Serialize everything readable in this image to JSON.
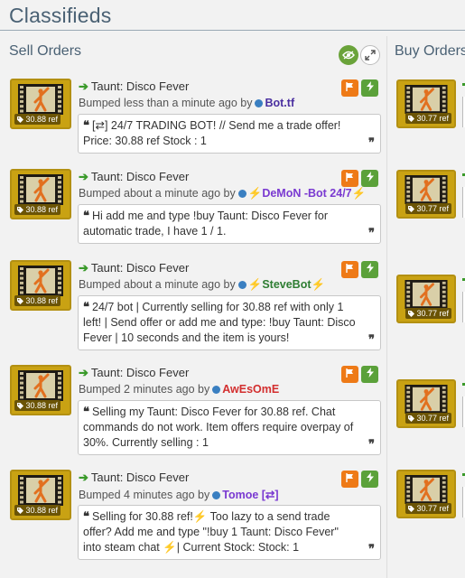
{
  "page": {
    "title": "Classifieds"
  },
  "sections": {
    "sell": "Sell Orders",
    "buy": "Buy Orders"
  },
  "icons": {
    "eye": "eye-icon",
    "expand": "expand-icon",
    "flag": "flag-icon",
    "trade": "lightning-icon",
    "quote_open": "quote-open-icon",
    "quote_close": "quote-close-icon",
    "arrow": "arrow-right-icon"
  },
  "colors": {
    "item_border": "#c9a213",
    "trade_green": "#5ba13a",
    "report_orange": "#ee7a17",
    "online_dot": "#3a7fc1"
  },
  "sell_orders": [
    {
      "item": "Taunt: Disco Fever",
      "price": "30.88 ref",
      "bumped": "Bumped less than a minute ago by",
      "user_prefix": "",
      "user": "Bot.tf",
      "user_suffix": "",
      "user_color": "#4a2fa0",
      "details": "[⇄] 24/7 TRADING BOT! // Send me a trade offer! Price: 30.88 ref Stock : 1"
    },
    {
      "item": "Taunt: Disco Fever",
      "price": "30.88 ref",
      "bumped": "Bumped about a minute ago by",
      "user_prefix": "⚡",
      "user": "DeMoN -Bot 24/7",
      "user_suffix": "⚡",
      "user_color": "#7a3ad1",
      "details": "Hi add me and type !buy Taunt: Disco Fever for automatic trade, I have 1 / 1."
    },
    {
      "item": "Taunt: Disco Fever",
      "price": "30.88 ref",
      "bumped": "Bumped about a minute ago by",
      "user_prefix": "⚡",
      "user": "SteveBot",
      "user_suffix": "⚡",
      "user_color": "#2e7d32",
      "details": "24/7 bot | Currently selling for 30.88 ref with only 1 left! | Send offer or add me and type: !buy Taunt: Disco Fever | 10 seconds and the item is yours!"
    },
    {
      "item": "Taunt: Disco Fever",
      "price": "30.88 ref",
      "bumped": "Bumped 2 minutes ago by",
      "user_prefix": "",
      "user": "AwEsOmE",
      "user_suffix": "",
      "user_color": "#d32f2f",
      "details": "Selling my Taunt: Disco Fever for 30.88 ref. Chat commands do not work. Item offers require overpay of 30%. Currently selling : 1"
    },
    {
      "item": "Taunt: Disco Fever",
      "price": "30.88 ref",
      "bumped": "Bumped 4 minutes ago by",
      "user_prefix": "",
      "user": "Tomoe [⇄]",
      "user_suffix": "",
      "user_color": "#7a3ad1",
      "details": "Selling for 30.88 ref!⚡ Too lazy to a send trade offer? Add me and type \"!buy 1 Taunt: Disco Fever\" into steam chat ⚡| Current Stock: Stock: 1"
    }
  ],
  "buy_orders": [
    {
      "price": "30.77 ref"
    },
    {
      "price": "30.77 ref"
    },
    {
      "price": "30.77 ref"
    },
    {
      "price": "30.77 ref"
    },
    {
      "price": "30.77 ref"
    }
  ]
}
